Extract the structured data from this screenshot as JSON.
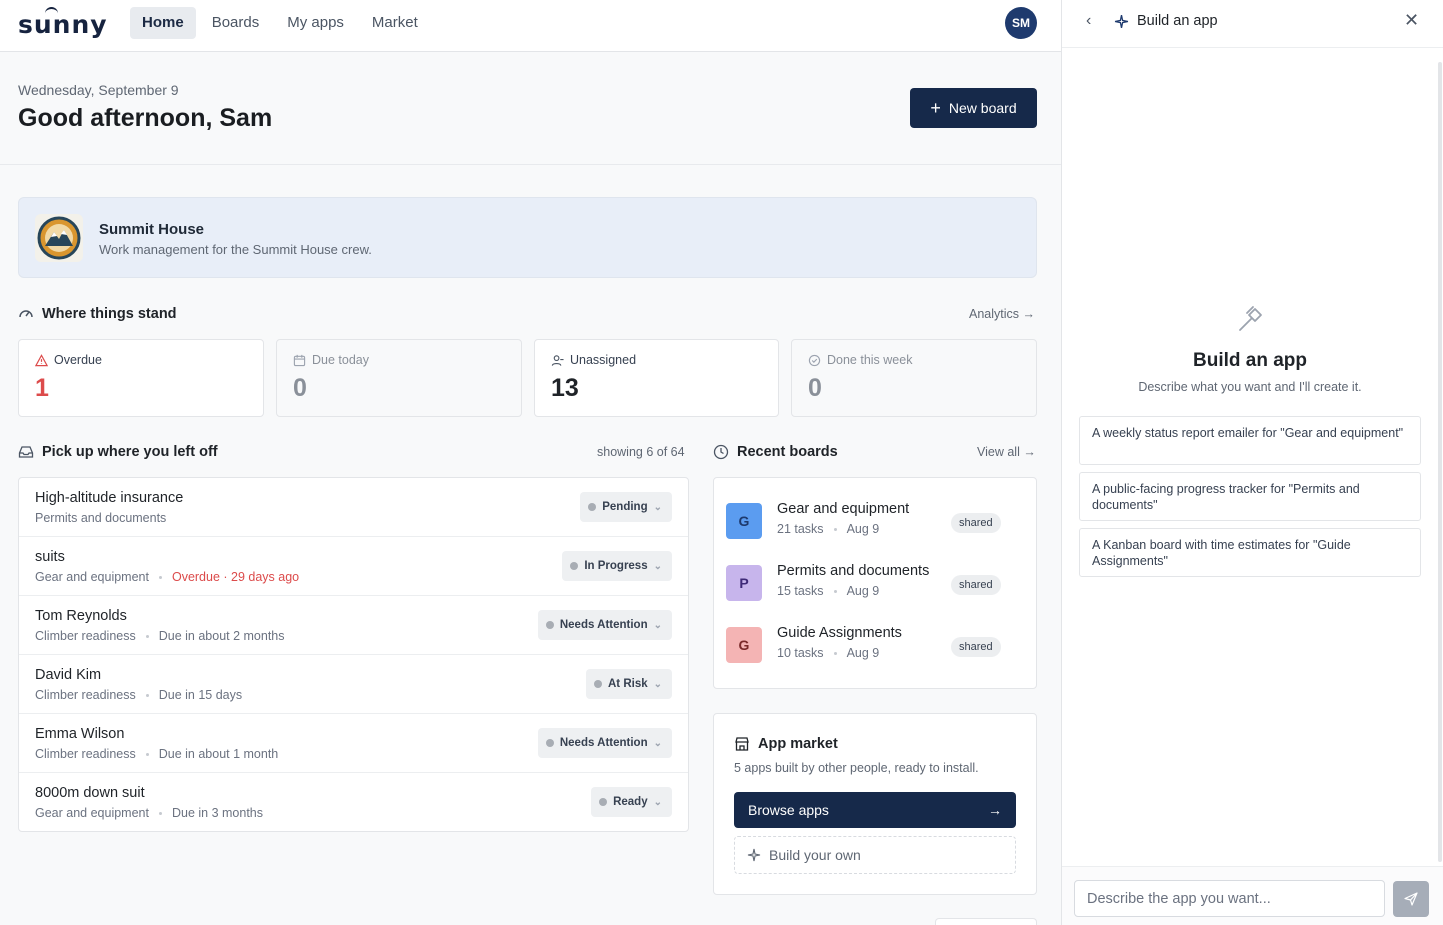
{
  "brand": {
    "logo_text": "sunny"
  },
  "nav": {
    "items": [
      {
        "label": "Home"
      },
      {
        "label": "Boards"
      },
      {
        "label": "My apps"
      },
      {
        "label": "Market"
      }
    ]
  },
  "user": {
    "initials": "SM"
  },
  "header": {
    "date": "Wednesday, September 9",
    "greeting": "Good afternoon, Sam",
    "new_board_label": "New board"
  },
  "workspace": {
    "name": "Summit House",
    "description": "Work management for the Summit House crew."
  },
  "stats_section": {
    "title": "Where things stand",
    "link": "Analytics",
    "cards": [
      {
        "label": "Overdue",
        "value": "1"
      },
      {
        "label": "Due today",
        "value": "0"
      },
      {
        "label": "Unassigned",
        "value": "13"
      },
      {
        "label": "Done this week",
        "value": "0"
      }
    ]
  },
  "pickup": {
    "title": "Pick up where you left off",
    "count": "showing 6 of 64",
    "tasks": [
      {
        "title": "High-altitude insurance",
        "board": "Permits and documents",
        "due": "",
        "status": "Pending"
      },
      {
        "title": "suits",
        "board": "Gear and equipment",
        "due": "Overdue · 29 days ago",
        "status": "In Progress"
      },
      {
        "title": "Tom Reynolds",
        "board": "Climber readiness",
        "due": "Due in about 2 months",
        "status": "Needs Attention"
      },
      {
        "title": "David Kim",
        "board": "Climber readiness",
        "due": "Due in 15 days",
        "status": "At Risk"
      },
      {
        "title": "Emma Wilson",
        "board": "Climber readiness",
        "due": "Due in about 1 month",
        "status": "Needs Attention"
      },
      {
        "title": "8000m down suit",
        "board": "Gear and equipment",
        "due": "Due in 3 months",
        "status": "Ready"
      }
    ]
  },
  "recent": {
    "title": "Recent boards",
    "link": "View all",
    "boards": [
      {
        "letter": "G",
        "name": "Gear and equipment",
        "tasks": "21 tasks",
        "date": "Aug 9",
        "badge": "shared",
        "color": "#5b9cf0"
      },
      {
        "letter": "P",
        "name": "Permits and documents",
        "tasks": "15 tasks",
        "date": "Aug 9",
        "badge": "shared",
        "color": "#c7b5ec"
      },
      {
        "letter": "G",
        "name": "Guide Assignments",
        "tasks": "10 tasks",
        "date": "Aug 9",
        "badge": "shared",
        "color": "#f4b4b4"
      }
    ]
  },
  "market": {
    "title": "App market",
    "description": "5 apps built by other people, ready to install.",
    "browse_label": "Browse apps",
    "build_label": "Build your own"
  },
  "panel": {
    "title": "Build an app",
    "heading": "Build an app",
    "subtitle": "Describe what you want and I'll create it.",
    "suggestions": [
      "A weekly status report emailer for \"Gear and equipment\"",
      "A public-facing progress tracker for \"Permits and documents\"",
      "A Kanban board with time estimates for \"Guide Assignments\""
    ],
    "input_placeholder": "Describe the app you want..."
  },
  "colors": {
    "primary": "#16294a",
    "danger": "#dc4b4b",
    "workspace_bg": "#e8eef8"
  }
}
